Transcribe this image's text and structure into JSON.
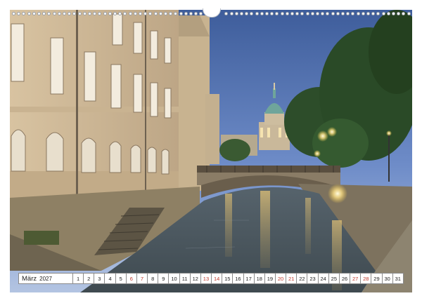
{
  "calendar": {
    "month": "März",
    "year": "2027",
    "days": [
      {
        "n": "1",
        "weekend": false
      },
      {
        "n": "2",
        "weekend": false
      },
      {
        "n": "3",
        "weekend": false
      },
      {
        "n": "4",
        "weekend": false
      },
      {
        "n": "5",
        "weekend": false
      },
      {
        "n": "6",
        "weekend": true
      },
      {
        "n": "7",
        "weekend": true
      },
      {
        "n": "8",
        "weekend": false
      },
      {
        "n": "9",
        "weekend": false
      },
      {
        "n": "10",
        "weekend": false
      },
      {
        "n": "11",
        "weekend": false
      },
      {
        "n": "12",
        "weekend": false
      },
      {
        "n": "13",
        "weekend": true
      },
      {
        "n": "14",
        "weekend": true
      },
      {
        "n": "15",
        "weekend": false
      },
      {
        "n": "16",
        "weekend": false
      },
      {
        "n": "17",
        "weekend": false
      },
      {
        "n": "18",
        "weekend": false
      },
      {
        "n": "19",
        "weekend": false
      },
      {
        "n": "20",
        "weekend": true
      },
      {
        "n": "21",
        "weekend": true
      },
      {
        "n": "22",
        "weekend": false
      },
      {
        "n": "23",
        "weekend": false
      },
      {
        "n": "24",
        "weekend": false
      },
      {
        "n": "25",
        "weekend": false
      },
      {
        "n": "26",
        "weekend": false
      },
      {
        "n": "27",
        "weekend": true
      },
      {
        "n": "28",
        "weekend": true
      },
      {
        "n": "29",
        "weekend": false
      },
      {
        "n": "30",
        "weekend": false
      },
      {
        "n": "31",
        "weekend": false
      }
    ]
  },
  "colors": {
    "weekend": "#c0392b",
    "sky_top": "#3f5f9c",
    "sky_bottom": "#a9bde0",
    "building": "#d9c4a4",
    "water": "#4d5a60",
    "light": "#fff2b0"
  }
}
